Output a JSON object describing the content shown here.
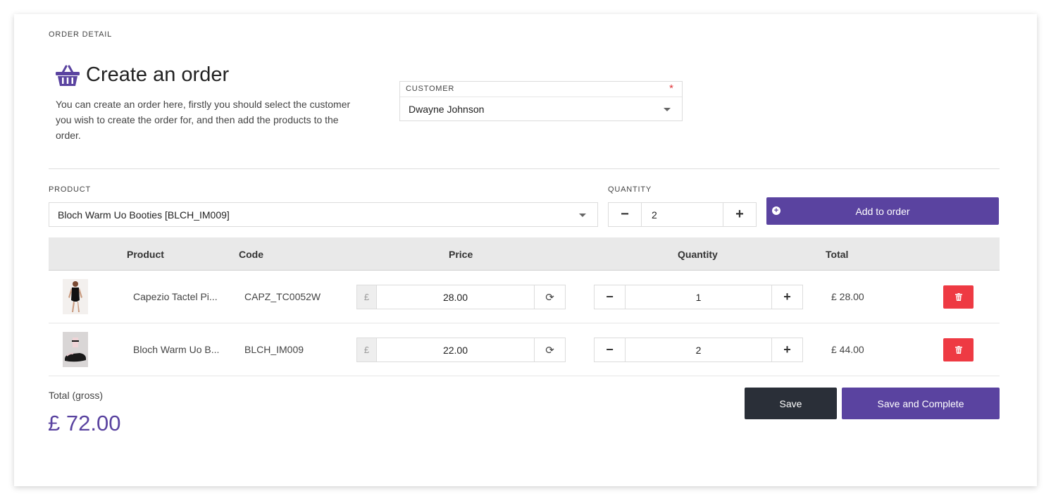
{
  "header": {
    "section_label": "ORDER DETAIL",
    "title": "Create an order",
    "description": "You can create an order here, firstly you should select the customer you wish to create the order for, and then add the products to the order.",
    "title_icon": "basket-icon"
  },
  "customer": {
    "label": "CUSTOMER",
    "required_mark": "*",
    "value": "Dwayne Johnson"
  },
  "product_picker": {
    "label": "PRODUCT",
    "value": "Bloch Warm Uo Booties [BLCH_IM009]",
    "quantity_label": "QUANTITY",
    "quantity_value": "2",
    "minus": "−",
    "plus": "+",
    "add_button": "Add to order"
  },
  "table": {
    "columns": [
      "Product",
      "Code",
      "Price",
      "Quantity",
      "Total"
    ],
    "rows": [
      {
        "product": "Capezio Tactel Pi...",
        "code": "CAPZ_TC0052W",
        "currency": "£",
        "price": "28.00",
        "quantity": "1",
        "total": "£ 28.00"
      },
      {
        "product": "Bloch Warm Uo B...",
        "code": "BLCH_IM009",
        "currency": "£",
        "price": "22.00",
        "quantity": "2",
        "total": "£ 44.00"
      }
    ],
    "refresh_glyph": "⟳",
    "minus": "−",
    "plus": "+"
  },
  "summary": {
    "total_label": "Total (gross)",
    "total_value": "£ 72.00"
  },
  "actions": {
    "save": "Save",
    "save_complete": "Save and Complete"
  },
  "colors": {
    "accent": "#5a43a0",
    "dark": "#2a2f38",
    "danger": "#ee3a43"
  }
}
